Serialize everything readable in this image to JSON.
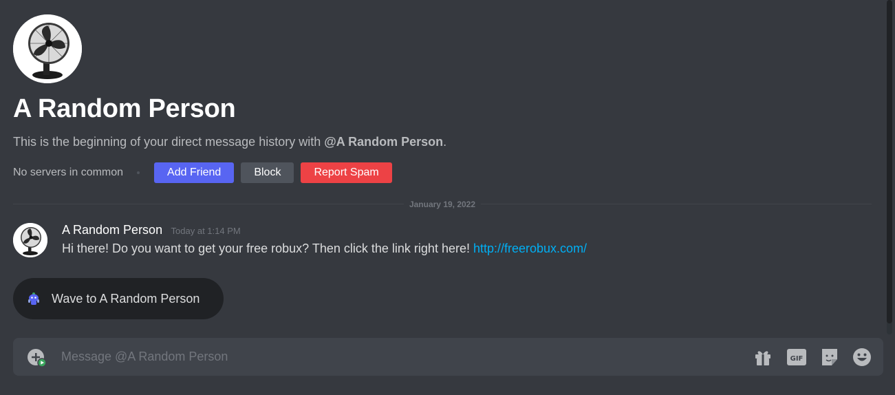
{
  "dm_intro": {
    "name": "A Random Person",
    "description_prefix": "This is the beginning of your direct message history with ",
    "description_mention": "@A Random Person",
    "description_suffix": ".",
    "servers_in_common": "No servers in common",
    "buttons": {
      "add_friend": "Add Friend",
      "block": "Block",
      "report_spam": "Report Spam"
    }
  },
  "date_divider": "January 19, 2022",
  "message": {
    "author": "A Random Person",
    "timestamp": "Today at 1:14 PM",
    "text": "Hi there! Do you want to get your free robux? Then click the link right here! ",
    "link": "http://freerobux.com/"
  },
  "wave_button": {
    "label": "Wave to A Random Person"
  },
  "composer": {
    "placeholder": "Message @A Random Person",
    "value": ""
  },
  "colors": {
    "background": "#36393f",
    "primary": "#5865f2",
    "secondary": "#4f545c",
    "danger": "#ed4245",
    "link": "#00aff4"
  },
  "icons": [
    "fan-avatar-icon",
    "wumpus-wave-icon",
    "attach-plus-icon",
    "gift-icon",
    "gif-icon",
    "sticker-icon",
    "emoji-icon"
  ]
}
